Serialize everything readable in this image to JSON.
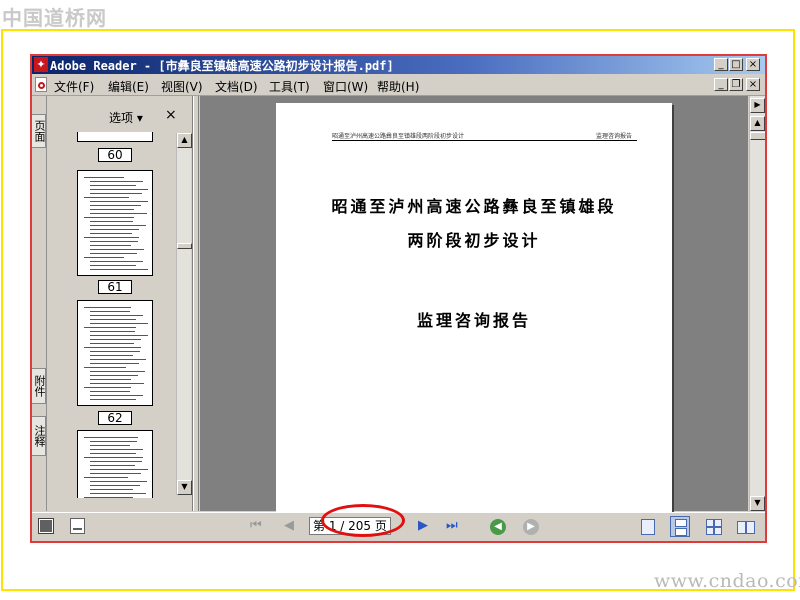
{
  "watermark": {
    "top": "中国道桥网",
    "bottom": "www.cndao.com"
  },
  "window": {
    "title": "Adobe Reader - [市彝良至镇雄高速公路初步设计报告.pdf]",
    "app_icon": "adobe-reader-icon",
    "buttons": {
      "minimize": "_",
      "maximize": "□",
      "close": "×",
      "restore": "❐"
    }
  },
  "menu": {
    "items": [
      "文件(F)",
      "编辑(E)",
      "视图(V)",
      "文档(D)",
      "工具(T)",
      "窗口(W)",
      "帮助(H)"
    ]
  },
  "side_tabs": [
    "页面",
    "附件",
    "注释"
  ],
  "nav_panel": {
    "options_label": "选项 ▾",
    "close_label": "×",
    "thumbnail_labels": [
      "60",
      "61",
      "62"
    ]
  },
  "document": {
    "running_header_left": "昭通至泸州高速公路彝良至镇雄段两阶段初步设计",
    "running_header_right": "监理咨询报告",
    "title_line1": "昭通至泸州高速公路彝良至镇雄段",
    "title_line2": "两阶段初步设计",
    "title_line3": "监理咨询报告"
  },
  "bottom_bar": {
    "page_field": "第 1 / 205 页",
    "current_page": 1,
    "total_pages": 205
  },
  "colors": {
    "highlight": "#e01010",
    "frame_yellow": "#ffe300",
    "title_bar": "#0a246a",
    "nav_green": "#4a9a4a"
  }
}
